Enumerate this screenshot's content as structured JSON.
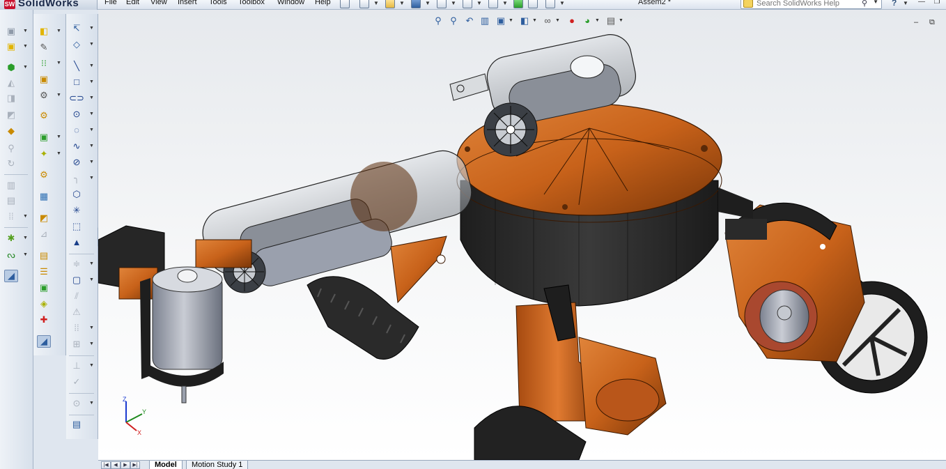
{
  "app": {
    "logo_text": "SolidWorks",
    "logo_badge": "SW",
    "document_title": "Assem2 *"
  },
  "menu": [
    "File",
    "Edit",
    "View",
    "Insert",
    "Tools",
    "Toolbox",
    "Window",
    "Help"
  ],
  "search": {
    "placeholder": "Search SolidWorks Help"
  },
  "help_glyph": "?",
  "tabs": {
    "model": "Model",
    "motion_study": "Motion Study 1"
  },
  "triad": {
    "x": "X",
    "y": "Y",
    "z": "Z"
  },
  "colors": {
    "accent_orange": "#c8621a",
    "dark_part": "#2b2b2b",
    "motor_grey": "#9aa0ad",
    "ui_chrome": "#dfe6ef"
  },
  "toolbars": {
    "assembly": [
      "insert-components-icon",
      "new-part-icon",
      "mate-icon",
      "linear-pattern-icon",
      "smart-fasteners-icon",
      "move-component-icon",
      "show-hidden-icon",
      "assembly-features-icon",
      "reference-geometry-icon",
      "new-motion-study-icon",
      "bill-of-materials-icon",
      "exploded-view-icon",
      "explode-line-sketch-icon",
      "interference-detection-icon",
      "instant3d-icon"
    ],
    "features": [
      "extruded-boss-icon",
      "revolved-boss-icon",
      "swept-boss-icon",
      "lofted-boss-icon",
      "extruded-cut-icon",
      "fillet-icon",
      "chamfer-icon",
      "rib-icon",
      "shell-icon",
      "draft-icon",
      "pattern-icon",
      "mirror-icon",
      "curves-icon",
      "rapid-sketch-icon"
    ],
    "sketch": [
      "smart-dimension-icon",
      "line-icon",
      "rectangle-icon",
      "slot-icon",
      "circle-icon",
      "arc-icon",
      "spline-icon",
      "ellipse-icon",
      "fillet-sketch-icon",
      "polygon-icon",
      "point-icon",
      "centerline-icon",
      "text-icon",
      "trim-icon",
      "convert-entities-icon",
      "offset-icon",
      "mirror-entities-icon",
      "pattern-entities-icon",
      "relations-icon",
      "repair-sketch-icon",
      "quick-snaps-icon",
      "rapid-sketch-icon"
    ]
  }
}
